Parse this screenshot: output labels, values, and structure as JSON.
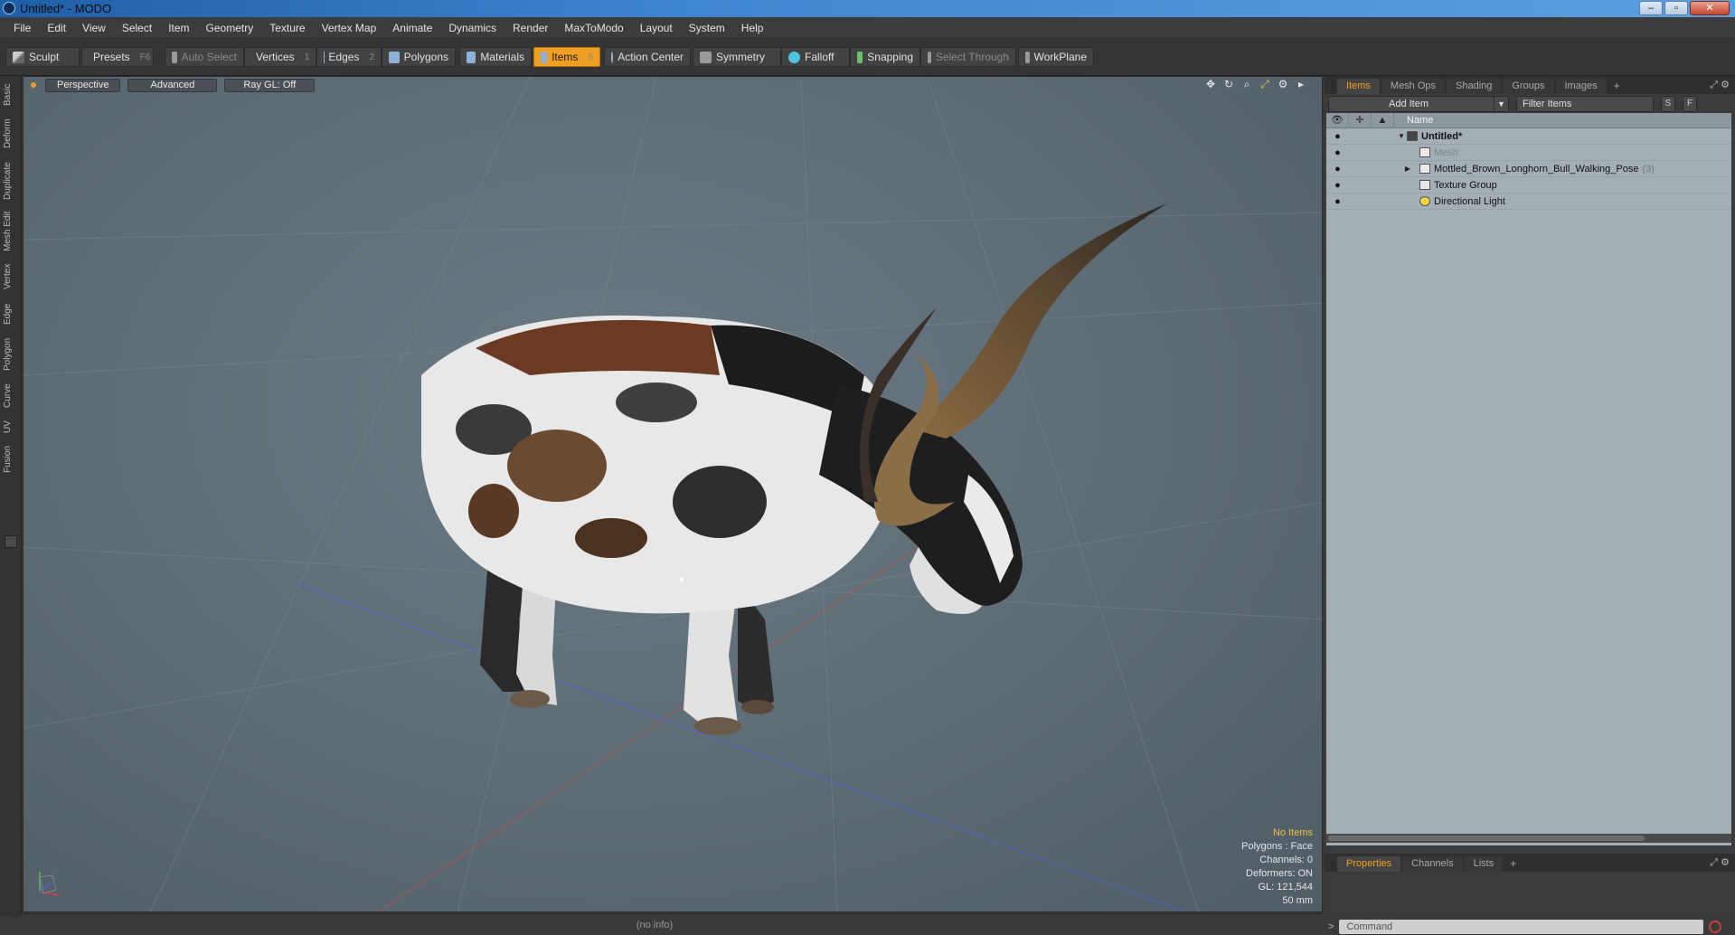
{
  "window": {
    "title": "Untitled* - MODO",
    "minimize": "–",
    "maximize": "▫",
    "close": "✕"
  },
  "menu": [
    "File",
    "Edit",
    "View",
    "Select",
    "Item",
    "Geometry",
    "Texture",
    "Vertex Map",
    "Animate",
    "Dynamics",
    "Render",
    "MaxToModo",
    "Layout",
    "System",
    "Help"
  ],
  "toolbar": {
    "sculpt": "Sculpt",
    "presets": "Presets",
    "presets_key": "F6",
    "auto_select": "Auto Select",
    "vertices": "Vertices",
    "vertices_key": "1",
    "edges": "Edges",
    "edges_key": "2",
    "polygons": "Polygons",
    "materials": "Materials",
    "items": "Items",
    "items_key": "5",
    "action_center": "Action Center",
    "symmetry": "Symmetry",
    "falloff": "Falloff",
    "snapping": "Snapping",
    "select_through": "Select Through",
    "workplane": "WorkPlane"
  },
  "left_tabs": [
    "Basic",
    "Deform",
    "Duplicate",
    "Mesh Edit",
    "Vertex",
    "Edge",
    "Polygon",
    "Curve",
    "UV",
    "Fusion"
  ],
  "viewport": {
    "view": "Perspective",
    "shading": "Advanced",
    "raygl": "Ray GL: Off",
    "stats": {
      "selection": "No Items",
      "polygons": "Polygons : Face",
      "channels": "Channels: 0",
      "deformers": "Deformers: ON",
      "gl": "GL: 121,544",
      "scale": "50 mm"
    }
  },
  "items_panel": {
    "tabs": [
      "Items",
      "Mesh Ops",
      "Shading",
      "Groups",
      "Images"
    ],
    "add_item": "Add Item",
    "filter_placeholder": "Filter Items",
    "s_btn": "S",
    "f_btn": "F",
    "name_header": "Name",
    "rows": [
      {
        "label": "Untitled*"
      },
      {
        "label": "Mesh"
      },
      {
        "label": "Mottled_Brown_Longhorn_Bull_Walking_Pose",
        "count": "(3)"
      },
      {
        "label": "Texture Group"
      },
      {
        "label": "Directional Light"
      }
    ]
  },
  "properties_panel": {
    "tabs": [
      "Properties",
      "Channels",
      "Lists"
    ]
  },
  "command": {
    "placeholder": "Command",
    "prompt": ">"
  },
  "status": {
    "info": "(no info)"
  },
  "colors": {
    "accent": "#f0a020",
    "viewport_bg": "#5d6b75",
    "tree_bg": "#a4aeb5"
  }
}
